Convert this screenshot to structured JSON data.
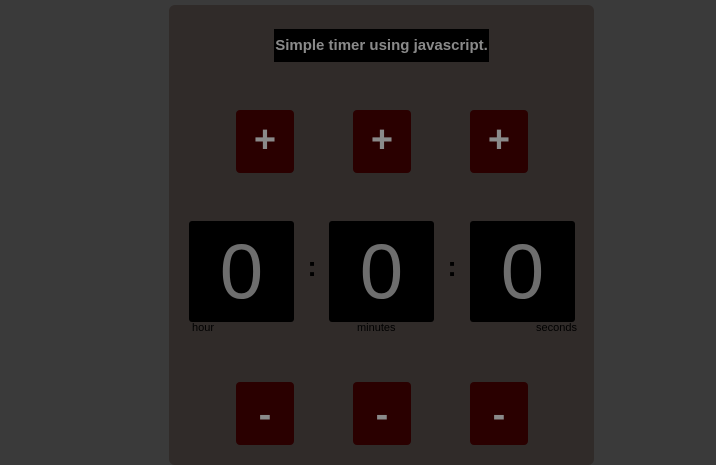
{
  "title": "Simple timer using javascript.",
  "controls": {
    "increment_label": "+",
    "decrement_label": "-"
  },
  "display": {
    "hours": "0",
    "minutes": "0",
    "seconds": "0",
    "separator": ":"
  },
  "units": {
    "hour": "hour",
    "minutes": "minutes",
    "seconds": "seconds"
  },
  "colors": {
    "page_background": "#3a3a3a",
    "panel_background": "#302b29",
    "button_background": "#2a0000",
    "digit_background": "#000000",
    "text_gray": "#8a8a8a"
  }
}
